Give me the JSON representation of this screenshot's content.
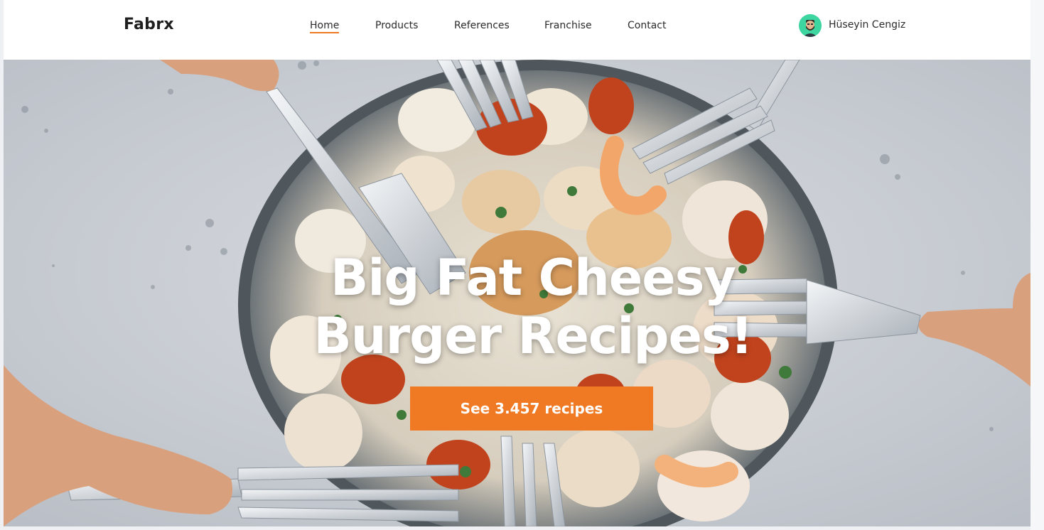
{
  "brand": {
    "logo_text": "Fabrx"
  },
  "nav": {
    "items": [
      {
        "label": "Home",
        "active": true
      },
      {
        "label": "Products",
        "active": false
      },
      {
        "label": "References",
        "active": false
      },
      {
        "label": "Franchise",
        "active": false
      },
      {
        "label": "Contact",
        "active": false
      }
    ]
  },
  "user": {
    "name": "Hüseyin Cengiz",
    "avatar_icon": "user-avatar-icon"
  },
  "hero": {
    "title_line1": "Big Fat Cheesy",
    "title_line2": "Burger Recipes!",
    "cta_label": "See 3.457 recipes",
    "image_icon": "food-plate-image"
  },
  "colors": {
    "accent": "#f07a24",
    "text_dark": "#2b2b2b",
    "avatar_bg": "#3ed6a0"
  }
}
